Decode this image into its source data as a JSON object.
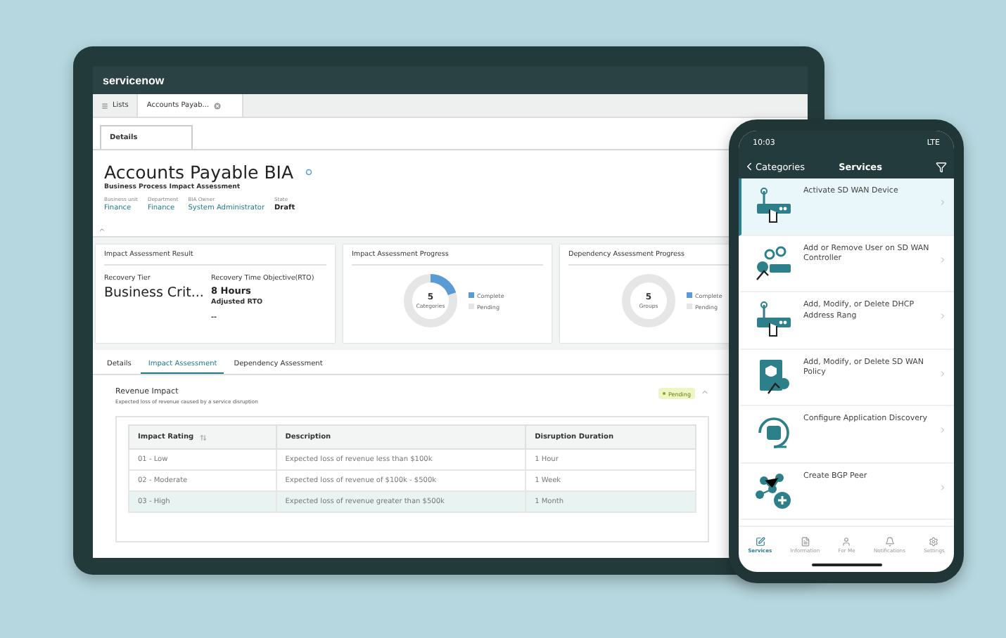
{
  "tablet": {
    "brand": "servicenow",
    "tabs": [
      {
        "label": "Lists",
        "selected": false
      },
      {
        "label": "Accounts Payab...",
        "selected": true
      }
    ],
    "record": {
      "tab": "Details",
      "title": "Accounts Payable BIA",
      "subtitle": "Business Process Impact Assessment",
      "fields": [
        {
          "label": "Business unit",
          "value": "Finance",
          "kind": "link"
        },
        {
          "label": "Department",
          "value": "Finance",
          "kind": "link"
        },
        {
          "label": "BIA Owner",
          "value": "System Administrator",
          "kind": "link"
        },
        {
          "label": "State",
          "value": "Draft",
          "kind": "plain"
        }
      ]
    },
    "result": {
      "title": "Impact Assessment Result",
      "tier_label": "Recovery Tier",
      "tier_value": "Business Crit...",
      "rto_label": "Recovery Time Objective(RTO)",
      "rto_value": "8 Hours",
      "adjusted_label": "Adjusted RTO",
      "adjusted_value": "--"
    },
    "progress": [
      {
        "title": "Impact Assessment Progress",
        "count": "5",
        "unit": "Categories",
        "level": 0.2,
        "legend": [
          {
            "label": "Complete",
            "color": "#5b9bd5"
          },
          {
            "label": "Pending",
            "color": "#e6e6e6"
          }
        ]
      },
      {
        "title": "Dependency Assessment Progress",
        "count": "5",
        "unit": "Groups",
        "legend": [
          {
            "label": "Complete",
            "color": "#5b9bd5"
          },
          {
            "label": "Pending",
            "color": "#e6e6e6"
          }
        ]
      }
    ],
    "section_tabs": [
      {
        "label": "Details",
        "selected": false
      },
      {
        "label": "Impact Assessment",
        "selected": true
      },
      {
        "label": "Dependency Assessment",
        "selected": false
      }
    ],
    "section": {
      "title": "Revenue Impact",
      "description": "Expected loss of revenue caused by a service disruption",
      "status": "Pending",
      "expanded": true
    },
    "table": {
      "columns": [
        "Impact Rating",
        "Description",
        "Disruption Duration"
      ],
      "rows": [
        {
          "cells": [
            "01 - Low",
            "Expected loss of revenue less than $100k",
            "1 Hour"
          ],
          "selected": false
        },
        {
          "cells": [
            "02 - Moderate",
            "Expected loss of revenue of $100k - $500k",
            "1 Week"
          ],
          "selected": false
        },
        {
          "cells": [
            "03 - High",
            "Expected loss of revenue greater than $500k",
            "1 Month"
          ],
          "selected": true
        }
      ]
    }
  },
  "phone": {
    "time": "10:03",
    "network": "LTE",
    "back": "Categories",
    "title": "Services",
    "items": [
      {
        "label": "Activate SD WAN Device",
        "selected": true
      },
      {
        "label": "Add or Remove User on SD WAN Controller",
        "selected": false
      },
      {
        "label": "Add, Modify, or Delete DHCP Address Rang",
        "selected": false
      },
      {
        "label": "Add, Modify, or Delete SD WAN Policy",
        "selected": false
      },
      {
        "label": "Configure Application Discovery",
        "selected": false
      },
      {
        "label": "Create BGP Peer",
        "selected": false
      }
    ],
    "nav": [
      {
        "label": "Services",
        "selected": true
      },
      {
        "label": "Information",
        "selected": false
      },
      {
        "label": "For Me",
        "selected": false
      },
      {
        "label": "Notifications",
        "selected": false
      },
      {
        "label": "Settings",
        "selected": false
      }
    ]
  }
}
